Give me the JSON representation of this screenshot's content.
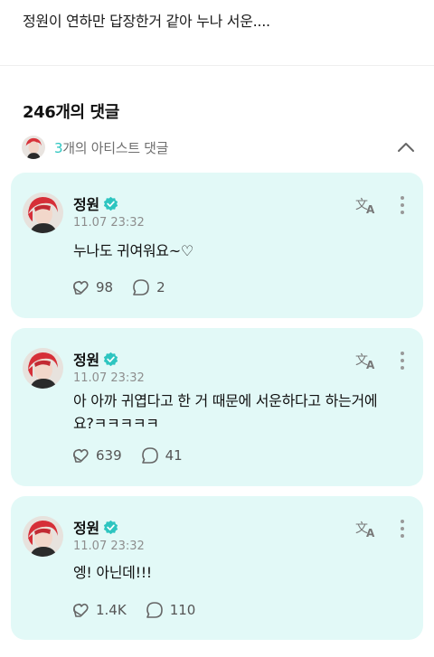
{
  "post": {
    "text": "정원이 연하만 답장한거 같아 누나 서운...."
  },
  "comments_header": {
    "count_label": "246개의 댓글"
  },
  "artist_comments": {
    "count": "3",
    "label": "개의 아티스트 댓글"
  },
  "colors": {
    "accent": "#2dc5c0",
    "card_bg": "#e2f9f7",
    "verified": "#2dc5c0"
  },
  "comments": [
    {
      "author": "정원",
      "date": "11.07 23:32",
      "lines": [
        "누나도 귀여워요~♡"
      ],
      "likes": "98",
      "replies": "2"
    },
    {
      "author": "정원",
      "date": "11.07 23:32",
      "lines": [
        "아 아까 귀엽다고 한 거 때문에 서운하다고 하는거에",
        "요?ㅋㅋㅋㅋㅋ"
      ],
      "likes": "639",
      "replies": "41"
    },
    {
      "author": "정원",
      "date": "11.07 23:32",
      "lines": [
        "엥! 아닌데!!!"
      ],
      "likes": "1.4K",
      "replies": "110"
    }
  ],
  "icons": {
    "translate": "translate-icon",
    "more": "more-vertical-icon",
    "like": "like-icon",
    "reply": "reply-icon",
    "verified": "verified-badge-icon",
    "collapse": "chevron-up-icon"
  }
}
